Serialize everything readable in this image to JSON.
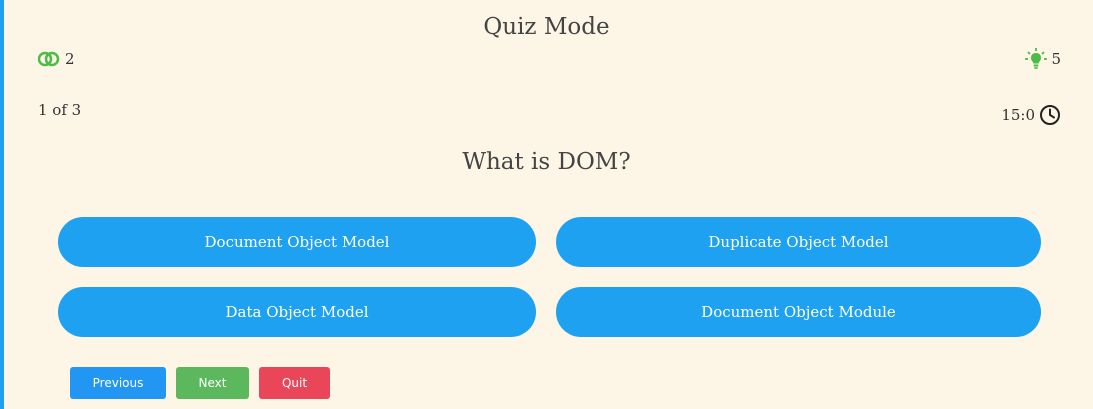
{
  "quiz": {
    "title": "Quiz Mode",
    "lifelines_count": "2",
    "hints_count": "5",
    "progress": "1 of 3",
    "timer": "15:0",
    "question": "What is DOM?"
  },
  "options": [
    "Document Object Model",
    "Duplicate Object Model",
    "Data Object Model",
    "Document Object Module"
  ],
  "controls": {
    "previous_label": "Previous",
    "next_label": "Next",
    "quit_label": "Quit"
  },
  "icons": {
    "lifelines": "fifty-fifty-icon",
    "hints": "lightbulb-icon",
    "timer": "clock-icon"
  },
  "colors": {
    "background": "#fdf5e6",
    "accent_blue": "#1fa1f1",
    "next_green": "#5cb85c",
    "quit_red": "#ea4659",
    "icon_green": "#4cbb47"
  }
}
